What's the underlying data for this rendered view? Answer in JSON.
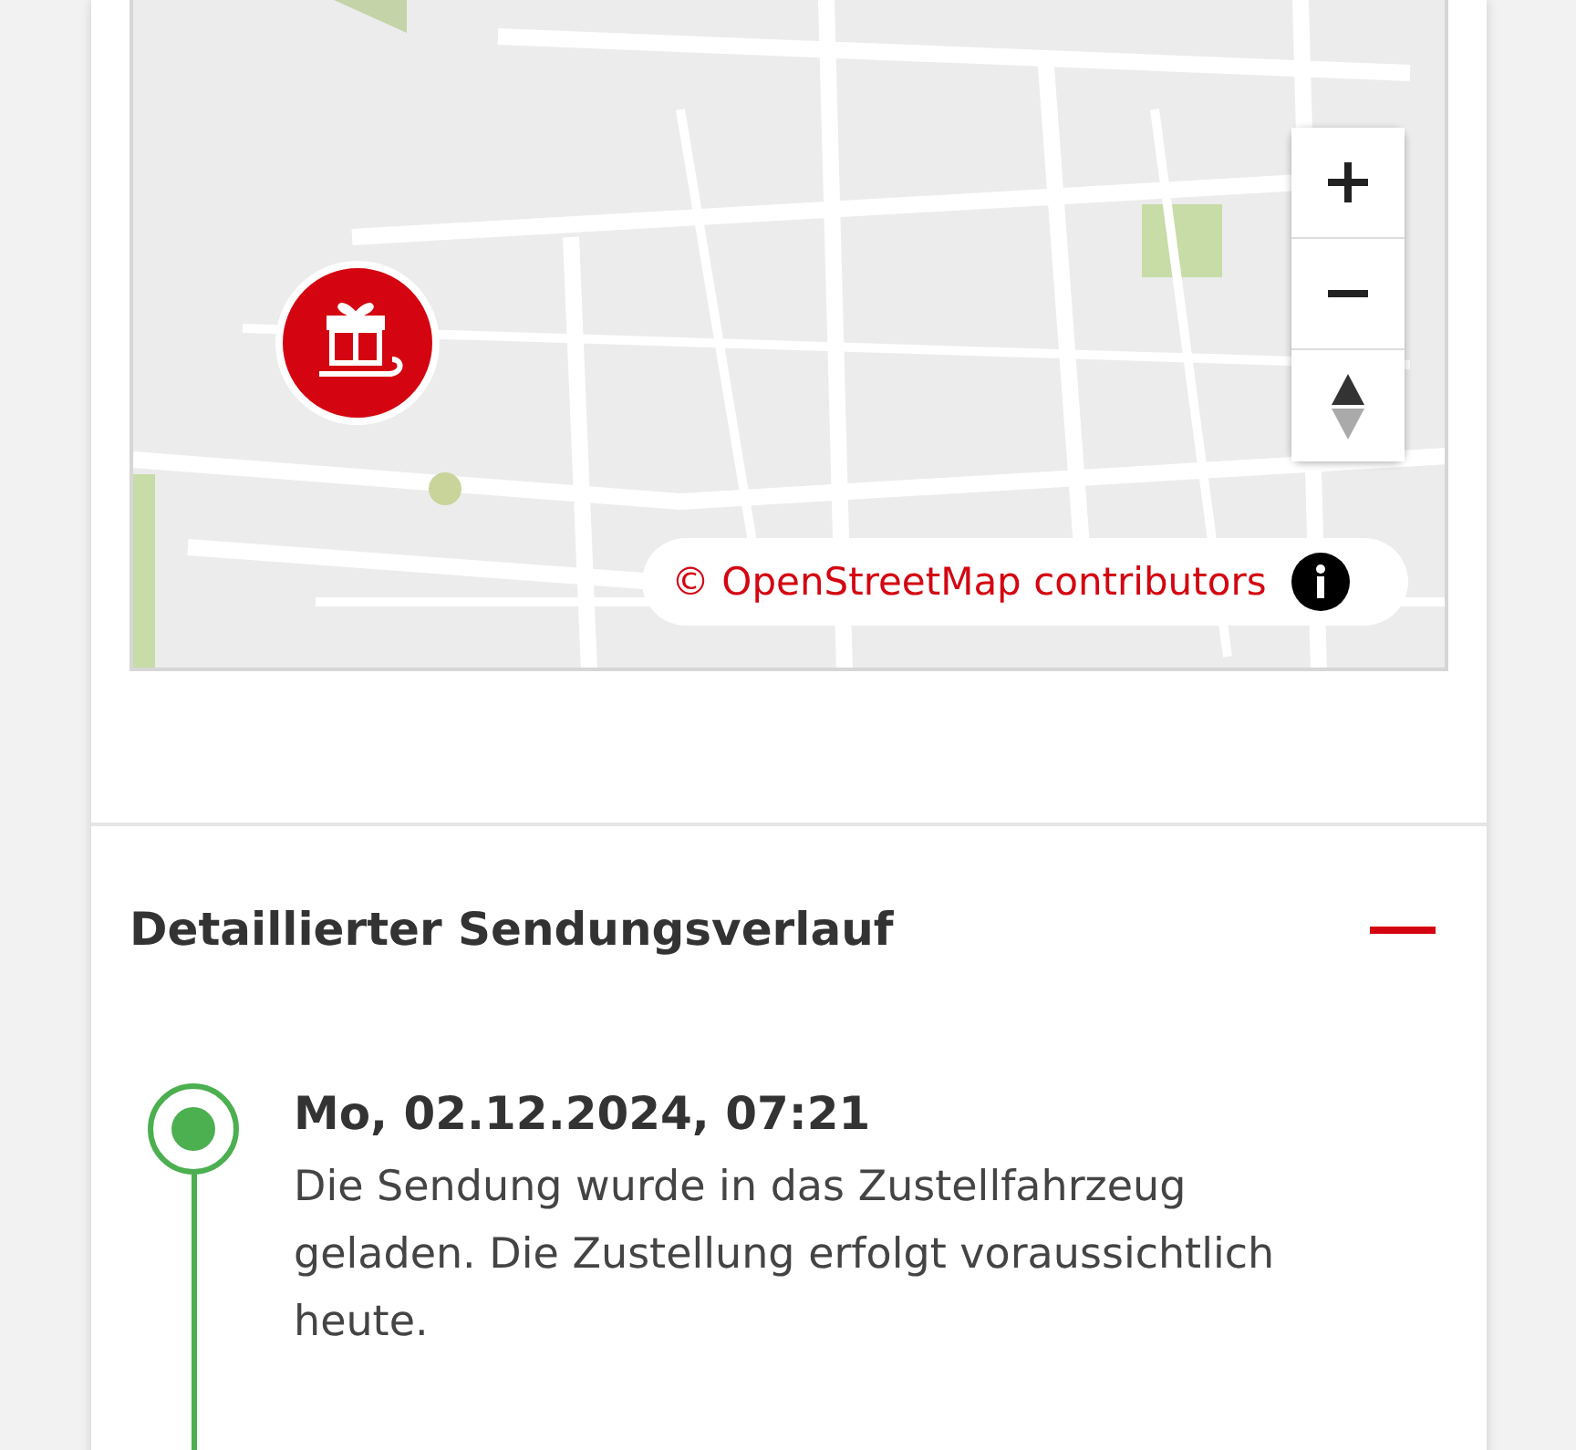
{
  "map": {
    "attribution": "© OpenStreetMap contributors"
  },
  "history": {
    "title": "Detaillierter Sendungsverlauf",
    "expanded": true,
    "events": [
      {
        "date": "Mo, 02.12.2024, 07:21",
        "text": "Die Sendung wurde in das Zustellfahrzeug geladen. Die Zustellung erfolgt voraussichtlich heute.",
        "current": true
      }
    ]
  }
}
